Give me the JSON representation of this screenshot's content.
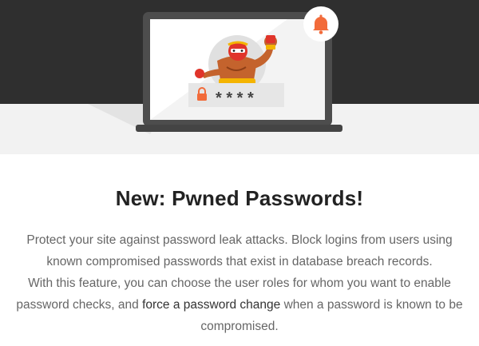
{
  "hero": {
    "password_mask": "* * * *",
    "icons": [
      "bell-icon",
      "lock-icon",
      "wrestler-mascot"
    ],
    "colors": {
      "dark_band": "#2f2f2f",
      "light_band": "#f2f2f2",
      "accent": "#f26b3a"
    }
  },
  "feature": {
    "title": "New: Pwned Passwords!",
    "line1": "Protect your site against password leak attacks. Block logins from users using known compromised passwords that exist in database breach records.",
    "line2_before": "With this feature, you can choose the user roles for whom you want to enable password checks, and ",
    "line2_highlight": "force a password change",
    "line2_after": " when a password is known to be compromised."
  }
}
